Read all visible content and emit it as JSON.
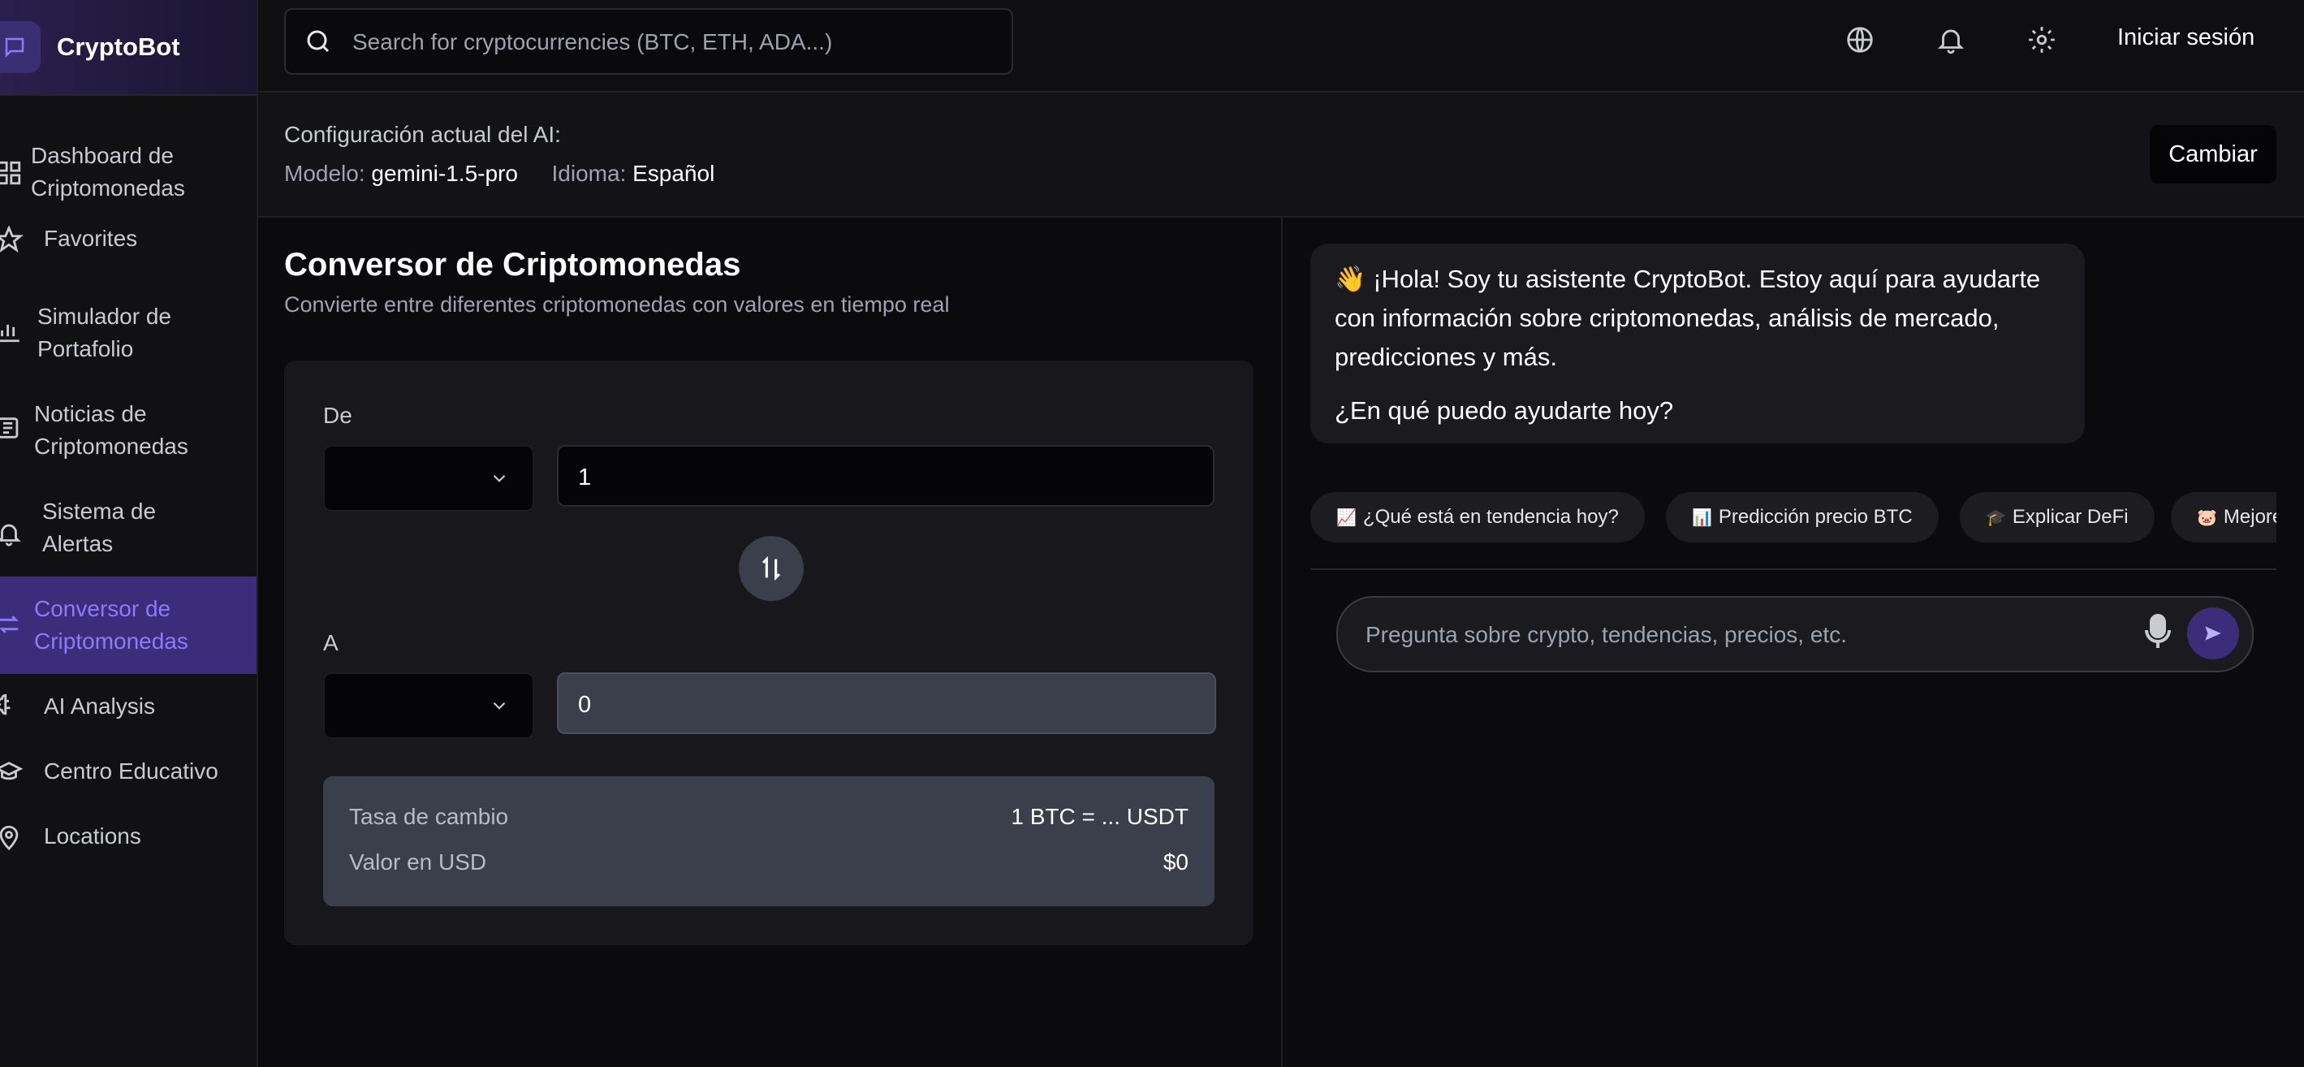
{
  "app": {
    "name": "CryptoBot"
  },
  "sidebar": {
    "items": [
      {
        "label_line1": "Dashboard de",
        "label_line2": "Criptomonedas",
        "icon": "grid-icon",
        "active": false
      },
      {
        "label_line1": "Favorites",
        "label_line2": "",
        "icon": "star-icon",
        "active": false
      },
      {
        "label_line1": "Simulador de",
        "label_line2": "Portafolio",
        "icon": "bar-chart-icon",
        "active": false
      },
      {
        "label_line1": "Noticias de",
        "label_line2": "Criptomonedas",
        "icon": "newspaper-icon",
        "active": false
      },
      {
        "label_line1": "Sistema de",
        "label_line2": "Alertas",
        "icon": "bell-icon",
        "active": false
      },
      {
        "label_line1": "Conversor de",
        "label_line2": "Criptomonedas",
        "icon": "arrows-exchange-icon",
        "active": true
      },
      {
        "label_line1": "AI Analysis",
        "label_line2": "",
        "icon": "brain-icon",
        "active": false
      },
      {
        "label_line1": "Centro Educativo",
        "label_line2": "",
        "icon": "graduation-cap-icon",
        "active": false
      },
      {
        "label_line1": "Locations",
        "label_line2": "",
        "icon": "map-pin-icon",
        "active": false
      }
    ],
    "active_color": "#8b7cf6"
  },
  "topbar": {
    "search_placeholder": "Search for cryptocurrencies (BTC, ETH, ADA...)",
    "icons": [
      "globe-icon",
      "bell-icon",
      "gear-icon"
    ],
    "login_label": "Iniciar sesión"
  },
  "ai_config": {
    "title": "Configuración actual del AI:",
    "model_label": "Modelo:",
    "model_value": "gemini-1.5-pro",
    "language_label": "Idioma:",
    "language_value": "Español",
    "change_button": "Cambiar"
  },
  "converter": {
    "title": "Conversor de Criptomonedas",
    "subtitle": "Convierte entre diferentes criptomonedas con valores en tiempo real",
    "from_label": "De",
    "from_amount": "1",
    "to_label": "A",
    "to_amount": "0",
    "rate_label": "Tasa de cambio",
    "rate_value": "1 BTC = ... USDT",
    "usd_label": "Valor en USD",
    "usd_value": "$0"
  },
  "chat": {
    "greeting_emoji": "👋",
    "greeting": "¡Hola! Soy tu asistente CryptoBot. Estoy aquí para ayudarte con información sobre criptomonedas, análisis de mercado, predicciones y más.",
    "question": "¿En qué puedo ayudarte hoy?",
    "suggestions": [
      {
        "emoji": "📈",
        "label": "¿Qué está en tendencia hoy?"
      },
      {
        "emoji": "📊",
        "label": "Predicción precio BTC"
      },
      {
        "emoji": "🎓",
        "label": "Explicar DeFi"
      },
      {
        "emoji": "🐷",
        "label": "Mejore"
      }
    ],
    "input_placeholder": "Pregunta sobre crypto, tendencias, precios, etc."
  },
  "colors": {
    "background": "#0b0b0e",
    "sidebar": "#111114",
    "accent": "#3b2d7a",
    "accent_text": "#8b7cf6",
    "card": "#18181c",
    "panel": "#3a3f4b"
  }
}
